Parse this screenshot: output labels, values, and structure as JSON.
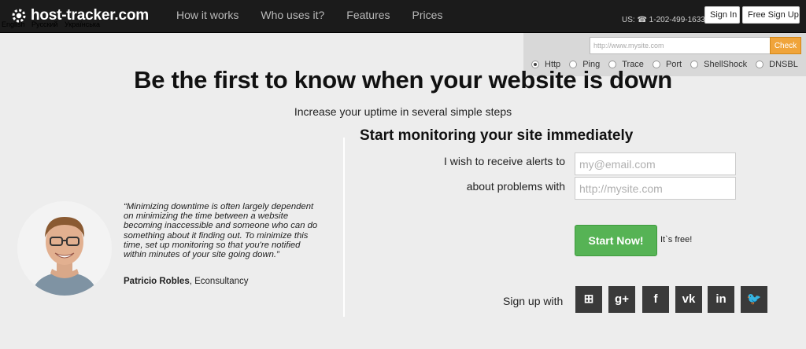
{
  "header": {
    "logo_text": "host-tracker.com",
    "logo_icon": "gear-logo-icon",
    "languages": [
      "English",
      "Русский",
      "Українська"
    ],
    "nav": [
      "How it works",
      "Who uses it?",
      "Features",
      "Prices"
    ],
    "phone": "US: ☎ 1-202-499-1633",
    "signin_label": "Sign In",
    "signup_label": "Free Sign Up"
  },
  "check": {
    "url_placeholder": "http://www.mysite.com",
    "button_label": "Check",
    "options": [
      "Http",
      "Ping",
      "Trace",
      "Port",
      "ShellShock",
      "DNSBL"
    ],
    "selected": "Http",
    "accent_color": "#f0a43a"
  },
  "hero": {
    "title": "Be the first to know when your website is down",
    "subtitle": "Increase your uptime in several simple steps"
  },
  "testimonial": {
    "quote": "“Minimizing downtime is often largely dependent on minimizing the time between a website becoming inaccessible and someone who can do something about it finding out. To minimize this time, set up monitoring so that you're notified within minutes of your site going down.”",
    "author_name": "Patricio Robles",
    "author_company": ", Econsultancy"
  },
  "form": {
    "title": "Start monitoring your site immediately",
    "alerts_label": "I wish to receive alerts to",
    "email_placeholder": "my@email.com",
    "problems_label": "about problems with",
    "site_placeholder": "http://mysite.com",
    "start_button": "Start Now!",
    "free_note": "It`s free!",
    "button_color": "#56b355",
    "signup_with": "Sign up with",
    "social": [
      {
        "name": "windows-icon",
        "glyph": "⊞"
      },
      {
        "name": "google-plus-icon",
        "glyph": "g+"
      },
      {
        "name": "facebook-icon",
        "glyph": "f"
      },
      {
        "name": "vk-icon",
        "glyph": "vk"
      },
      {
        "name": "linkedin-icon",
        "glyph": "in"
      },
      {
        "name": "twitter-icon",
        "glyph": "🐦"
      }
    ]
  }
}
